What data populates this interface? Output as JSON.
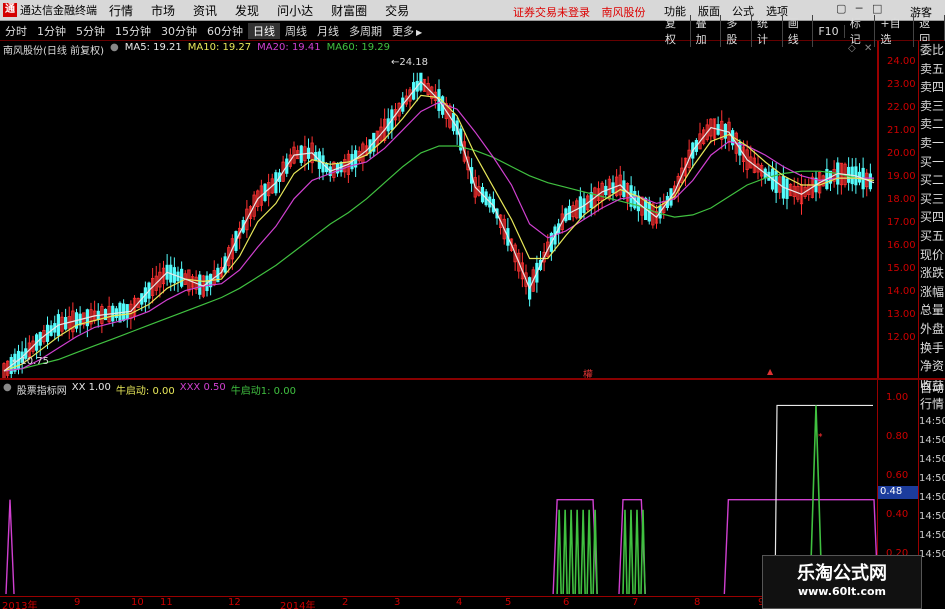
{
  "app": {
    "title": "通达信金融终端",
    "logo_glyph": "通",
    "menu": [
      "行情",
      "市场",
      "资讯",
      "发现",
      "问小达",
      "财富圈",
      "交易"
    ],
    "notice": "证券交易未登录",
    "stock_name_top": "南风股份",
    "right_menu": [
      "功能",
      "版面",
      "公式",
      "选项"
    ],
    "win_controls": [
      "▢",
      "─",
      "□",
      "✕"
    ],
    "guest_label": "游客"
  },
  "toolbar": {
    "periods": [
      "分时",
      "1分钟",
      "5分钟",
      "15分钟",
      "30分钟",
      "60分钟",
      "日线",
      "周线",
      "月线",
      "多周期",
      "更多"
    ],
    "active_period": "日线",
    "more_arrow": "▶",
    "right_buttons": [
      "复权",
      "叠加",
      "多股",
      "统计",
      "画线",
      "F10",
      "标记",
      "+自选",
      "返回"
    ]
  },
  "main_chart": {
    "stock_label": "南风股份(日线 前复权)",
    "indicators": [
      {
        "name": "MA5",
        "value": "19.21",
        "color": "#e8e8e8"
      },
      {
        "name": "MA10",
        "value": "19.27",
        "color": "#e8e85a"
      },
      {
        "name": "MA20",
        "value": "19.41",
        "color": "#d040d0"
      },
      {
        "name": "MA60",
        "value": "19.29",
        "color": "#40c040"
      }
    ],
    "high_label": "24.18",
    "low_label": "10.75",
    "marker_arrow": "←",
    "corner_icons": [
      "◇",
      "✕"
    ],
    "y_ticks": [
      "24.00",
      "23.00",
      "22.00",
      "21.00",
      "20.00",
      "19.00",
      "18.00",
      "17.00",
      "16.00",
      "15.00",
      "14.00",
      "13.00",
      "12.00"
    ],
    "event_marks": [
      "權",
      "▲"
    ]
  },
  "sidebar": {
    "items": [
      "委比",
      "卖五",
      "卖四",
      "卖三",
      "卖二",
      "卖一",
      "买一",
      "买二",
      "买三",
      "买四",
      "买五",
      "现价",
      "涨跌",
      "涨幅",
      "总量",
      "外盘",
      "换手",
      "净资",
      "收益"
    ]
  },
  "sidebar2": {
    "items": [
      "自动",
      "行情"
    ],
    "times": [
      "14:50",
      "14:50",
      "14:50",
      "14:50",
      "14:50",
      "14:50",
      "14:50",
      "14:50"
    ]
  },
  "sub_chart": {
    "indicator_name": "股票指标网",
    "values": [
      {
        "name": "XX",
        "value": "1.00",
        "color": "#e8e8e8"
      },
      {
        "name": "牛启动",
        "value": "0.00",
        "color": "#e8e85a"
      },
      {
        "name": "XXX",
        "value": "0.50",
        "color": "#d040d0"
      },
      {
        "name": "牛启动1",
        "value": "0.00",
        "color": "#40c040"
      }
    ],
    "y_ticks": [
      "1.00",
      "0.80",
      "0.60",
      "0.40",
      "0.20"
    ],
    "current_value": "0.48"
  },
  "x_axis": {
    "labels": [
      "2013年",
      "9",
      "10",
      "11",
      "12",
      "2014年",
      "2",
      "3",
      "4",
      "5",
      "6",
      "7",
      "8",
      "9"
    ]
  },
  "watermark": {
    "line1": "乐淘公式网",
    "line2": "www.60lt.com"
  },
  "chart_data": {
    "type": "line",
    "series": [
      {
        "name": "MA5",
        "color": "#e8e8e8",
        "values": [
          11.0,
          11.6,
          12.4,
          13.0,
          13.2,
          13.4,
          13.5,
          13.6,
          14.5,
          15.3,
          15.0,
          14.7,
          15.3,
          17.0,
          18.5,
          19.2,
          20.4,
          20.5,
          19.7,
          20.0,
          20.6,
          21.5,
          22.6,
          23.6,
          22.8,
          21.6,
          19.0,
          18.2,
          16.5,
          14.6,
          16.3,
          17.8,
          18.2,
          18.8,
          19.1,
          18.3,
          17.7,
          18.8,
          20.6,
          21.6,
          21.4,
          20.2,
          19.6,
          19.0,
          18.7,
          19.2,
          19.6,
          19.5,
          19.2
        ]
      },
      {
        "name": "MA10",
        "color": "#e8e85a",
        "values": [
          11.0,
          11.3,
          11.9,
          12.5,
          13.0,
          13.2,
          13.4,
          13.5,
          13.9,
          14.6,
          15.0,
          14.9,
          15.0,
          16.0,
          17.5,
          18.3,
          19.6,
          20.2,
          20.0,
          20.1,
          20.4,
          21.1,
          22.0,
          23.0,
          22.9,
          22.1,
          20.4,
          19.0,
          17.6,
          15.9,
          15.9,
          16.9,
          17.8,
          18.4,
          18.9,
          18.6,
          18.1,
          18.6,
          19.9,
          21.0,
          21.3,
          20.8,
          20.1,
          19.5,
          19.1,
          19.1,
          19.4,
          19.4,
          19.3
        ]
      },
      {
        "name": "MA20",
        "color": "#d040d0",
        "values": [
          11.0,
          11.1,
          11.5,
          12.0,
          12.5,
          12.9,
          13.1,
          13.3,
          13.6,
          14.1,
          14.5,
          14.7,
          14.8,
          15.4,
          16.4,
          17.3,
          18.5,
          19.3,
          19.6,
          19.9,
          20.1,
          20.7,
          21.5,
          22.3,
          22.7,
          22.4,
          21.4,
          20.3,
          19.1,
          17.4,
          16.8,
          17.1,
          17.6,
          18.1,
          18.5,
          18.6,
          18.3,
          18.5,
          19.3,
          20.4,
          21.0,
          20.8,
          20.4,
          19.9,
          19.5,
          19.3,
          19.4,
          19.4,
          19.4
        ]
      },
      {
        "name": "MA60",
        "color": "#40c040",
        "values": [
          11.0,
          11.1,
          11.3,
          11.5,
          11.8,
          12.1,
          12.4,
          12.7,
          13.0,
          13.3,
          13.6,
          13.9,
          14.2,
          14.6,
          15.1,
          15.6,
          16.2,
          16.8,
          17.4,
          17.9,
          18.5,
          19.2,
          19.9,
          20.5,
          20.8,
          20.8,
          20.6,
          20.3,
          19.9,
          19.5,
          19.2,
          19.0,
          18.8,
          18.6,
          18.4,
          18.2,
          17.9,
          17.7,
          17.8,
          18.1,
          18.6,
          19.1,
          19.4,
          19.6,
          19.7,
          19.7,
          19.6,
          19.4,
          19.3
        ]
      }
    ],
    "ylim": [
      11.0,
      24.5
    ],
    "high": 24.18,
    "low": 10.75,
    "sub_series": {
      "xxx_level": 0.5,
      "signal_windows": [
        [
          0.63,
          0.68
        ],
        [
          0.705,
          0.735
        ],
        [
          0.825,
          1.0
        ]
      ],
      "ylim": [
        0.0,
        1.05
      ]
    }
  }
}
